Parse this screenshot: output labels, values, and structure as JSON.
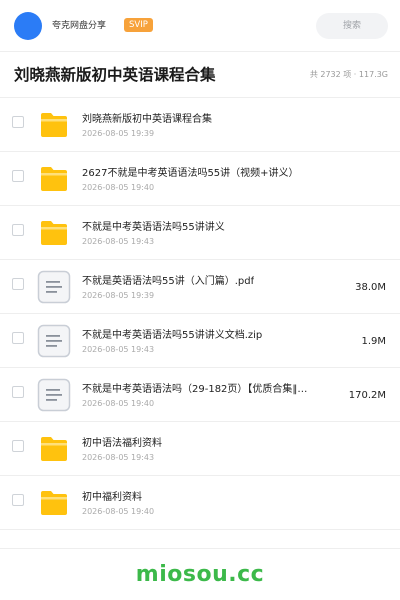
{
  "header": {
    "app_name": "夸克网盘分享",
    "badge": "SVIP",
    "search_label": "搜索"
  },
  "page": {
    "title": "刘晓燕新版初中英语课程合集",
    "summary": "共 2732 项 · 117.3G"
  },
  "files": [
    {
      "type": "folder",
      "name": "刘晓燕新版初中英语课程合集",
      "date": "2026-08-05 19:39",
      "size": ""
    },
    {
      "type": "folder",
      "name": "2627不就是中考英语语法吗55讲（视频+讲义）",
      "date": "2026-08-05 19:40",
      "size": ""
    },
    {
      "type": "folder",
      "name": "不就是中考英语语法吗55讲讲义",
      "date": "2026-08-05 19:43",
      "size": ""
    },
    {
      "type": "doc",
      "name": "不就是英语语法吗55讲（入门篇）.pdf",
      "date": "2026-08-05 19:39",
      "size": "38.0M"
    },
    {
      "type": "doc",
      "name": "不就是中考英语语法吗55讲讲义文档.zip",
      "date": "2026-08-05 19:43",
      "size": "1.9M"
    },
    {
      "type": "doc",
      "name": "不就是中考英语语法吗（29-182页）【优质合集‖…",
      "date": "2026-08-05 19:40",
      "size": "170.2M"
    },
    {
      "type": "folder",
      "name": "初中语法福利资料",
      "date": "2026-08-05 19:43",
      "size": ""
    },
    {
      "type": "folder",
      "name": "初中福利资料",
      "date": "2026-08-05 19:40",
      "size": ""
    }
  ],
  "icons": {
    "folder": "folder-icon",
    "doc": "document-icon"
  },
  "colors": {
    "accent": "#2b7cf6",
    "badge": "#f7a23a",
    "folder": "#ffc20e",
    "watermark": "#3cb94a"
  },
  "watermark": "miosou.cc"
}
